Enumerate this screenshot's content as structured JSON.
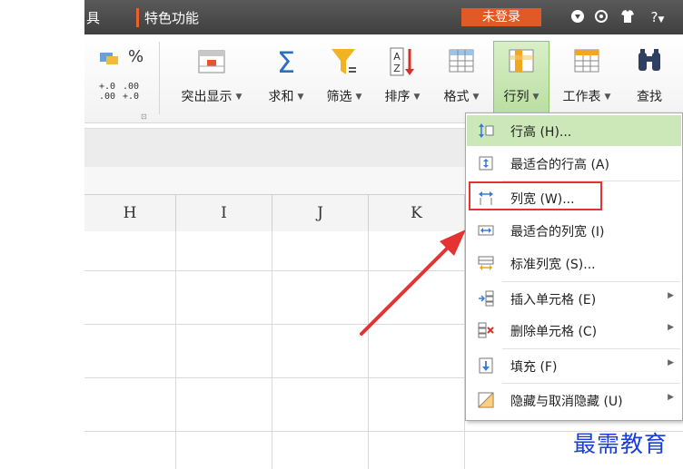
{
  "titlebar": {
    "menu_fragment": "具",
    "special_tab": "特色功能",
    "login_button": "未登录",
    "help_label": "?"
  },
  "ribbon": {
    "percent_symbol": "%",
    "increase_decimal": "+.0\n.00",
    "decrease_decimal": ".00\n+.0",
    "group_launcher": "⊡",
    "buttons": [
      {
        "label": "突出显示",
        "icon": "highlight-icon"
      },
      {
        "label": "求和",
        "icon": "sigma-icon"
      },
      {
        "label": "筛选",
        "icon": "filter-funnel-icon"
      },
      {
        "label": "排序",
        "icon": "sort-az-icon"
      },
      {
        "label": "格式",
        "icon": "format-table-icon"
      },
      {
        "label": "行列",
        "icon": "row-column-icon"
      },
      {
        "label": "工作表",
        "icon": "worksheet-icon"
      },
      {
        "label": "查找",
        "icon": "binoculars-icon"
      }
    ],
    "dropdown_arrow": "▼"
  },
  "grid": {
    "columns": [
      "H",
      "I",
      "J",
      "K"
    ]
  },
  "menu": {
    "items": [
      {
        "label": "行高 (H)...",
        "icon": "row-height-icon",
        "submenu": false
      },
      {
        "label": "最适合的行高 (A)",
        "icon": "autofit-row-height-icon",
        "submenu": false
      },
      {
        "label": "列宽 (W)...",
        "icon": "column-width-icon",
        "submenu": false
      },
      {
        "label": "最适合的列宽 (I)",
        "icon": "autofit-column-width-icon",
        "submenu": false
      },
      {
        "label": "标准列宽 (S)...",
        "icon": "standard-column-width-icon",
        "submenu": false
      },
      {
        "label": "插入单元格 (E)",
        "icon": "insert-cells-icon",
        "submenu": true
      },
      {
        "label": "删除单元格 (C)",
        "icon": "delete-cells-icon",
        "submenu": true
      },
      {
        "label": "填充 (F)",
        "icon": "fill-icon",
        "submenu": true
      },
      {
        "label": "隐藏与取消隐藏 (U)",
        "icon": "hide-unhide-icon",
        "submenu": true
      }
    ],
    "submenu_arrow": "▶"
  },
  "watermark": "最需教育",
  "colors": {
    "accent_green": "#8fc46b",
    "menu_highlight": "#cde8b8",
    "login_orange": "#e05a28",
    "annotation_red": "#e53333",
    "watermark_blue": "#1a3fd6"
  }
}
